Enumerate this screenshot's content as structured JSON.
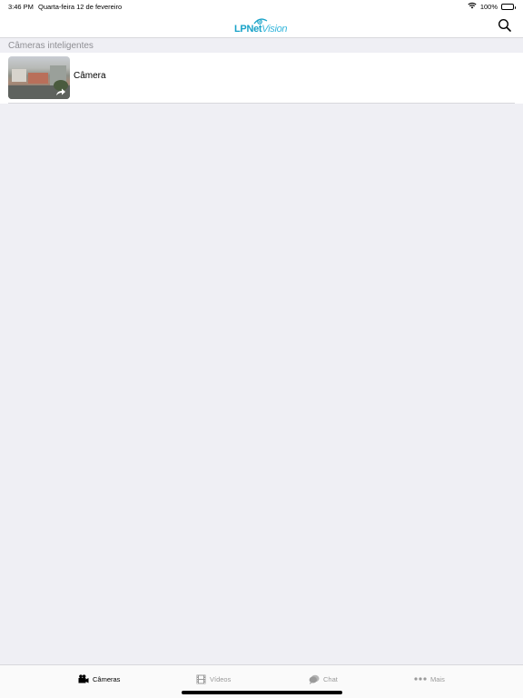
{
  "status_bar": {
    "time": "3:46 PM",
    "date": "Quarta-feira 12 de fevereiro",
    "battery": "100%"
  },
  "nav": {
    "logo_lp": "LPNet",
    "logo_vision": "Vision"
  },
  "section": {
    "title": "Câmeras inteligentes"
  },
  "cameras": [
    {
      "name": "Câmera"
    }
  ],
  "tabs": [
    {
      "label": "Câmeras",
      "icon": "camera-icon",
      "active": true
    },
    {
      "label": "Vídeos",
      "icon": "film-icon",
      "active": false
    },
    {
      "label": "Chat",
      "icon": "chat-icon",
      "active": false
    },
    {
      "label": "Mais",
      "icon": "more-icon",
      "active": false
    }
  ],
  "colors": {
    "brand": "#1aa3c8",
    "background": "#efeff4",
    "inactive_tab": "#9a9a9a"
  }
}
